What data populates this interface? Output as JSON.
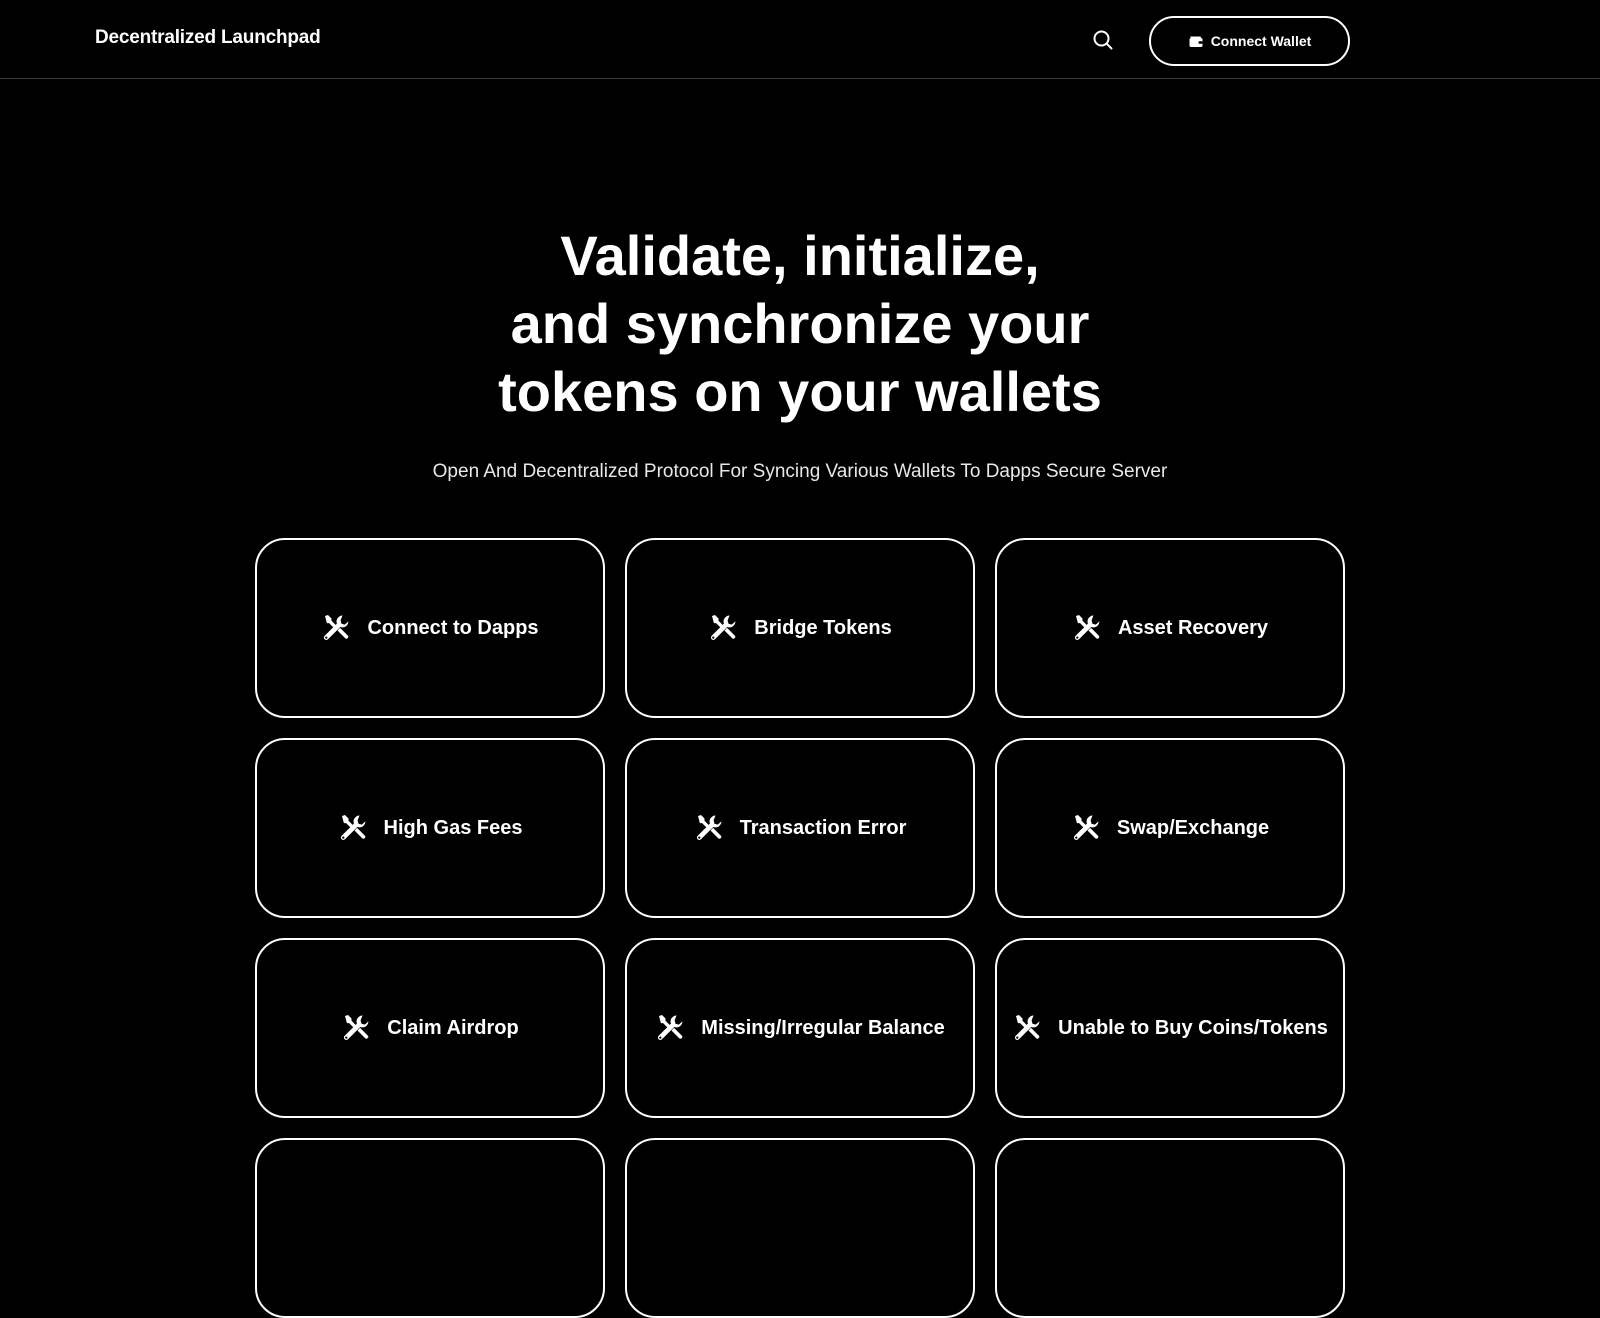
{
  "header": {
    "brand": "Decentralized Launchpad",
    "search_icon": "search-icon",
    "connect_button": {
      "label": "Connect Wallet",
      "icon": "wallet-icon"
    }
  },
  "hero": {
    "title_lines": [
      "Validate, initialize,",
      "and synchronize your",
      "tokens on your wallets"
    ],
    "subtitle": "Open And Decentralized Protocol For Syncing Various Wallets To Dapps Secure Server"
  },
  "services": {
    "icon": "tools-icon",
    "items": [
      {
        "label": "Connect to Dapps"
      },
      {
        "label": "Bridge Tokens"
      },
      {
        "label": "Asset Recovery"
      },
      {
        "label": "High Gas Fees"
      },
      {
        "label": "Transaction Error"
      },
      {
        "label": "Swap/Exchange"
      },
      {
        "label": "Claim Airdrop"
      },
      {
        "label": "Missing/Irregular Balance"
      },
      {
        "label": "Unable to Buy Coins/Tokens"
      },
      {
        "label": ""
      },
      {
        "label": ""
      },
      {
        "label": ""
      }
    ]
  },
  "colors": {
    "background": "#000000",
    "foreground": "#ffffff",
    "divider": "#3a3a3a"
  }
}
